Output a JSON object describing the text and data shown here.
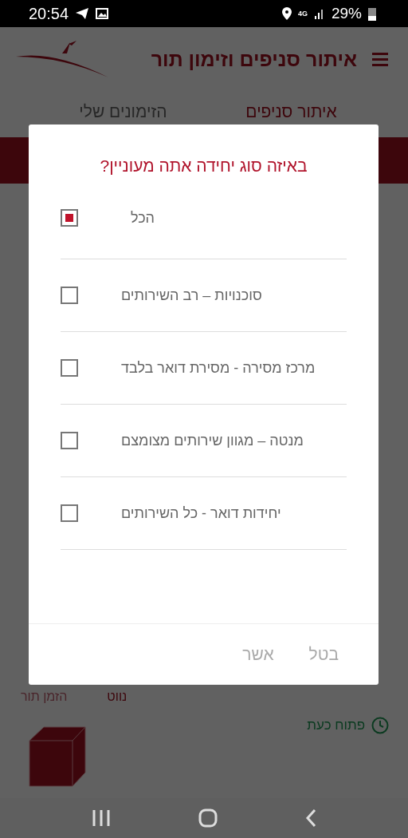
{
  "status_bar": {
    "time": "20:54",
    "network": "4G",
    "battery": "29%"
  },
  "app_bar": {
    "title": "איתור סניפים וזימון תור"
  },
  "tabs": [
    {
      "label": "איתור סניפים",
      "selected": true
    },
    {
      "label": "הזימונים שלי",
      "selected": false
    }
  ],
  "branch_card": {
    "actions": [
      "נווט",
      "הזמן תור"
    ],
    "status": "פתוח כעת"
  },
  "dialog": {
    "title": "באיזה סוג יחידה אתה מעוניין?",
    "options": [
      {
        "label": "הכל",
        "checked": true
      },
      {
        "label": "סוכנויות – רב השירותים",
        "checked": false
      },
      {
        "label": "מרכז מסירה - מסירת דואר בלבד",
        "checked": false
      },
      {
        "label": "מנטה – מגוון שירותים מצומצם",
        "checked": false
      },
      {
        "label": "יחידות דואר - כל השירותים",
        "checked": false
      }
    ],
    "buttons": [
      "בטל",
      "אשר"
    ]
  }
}
